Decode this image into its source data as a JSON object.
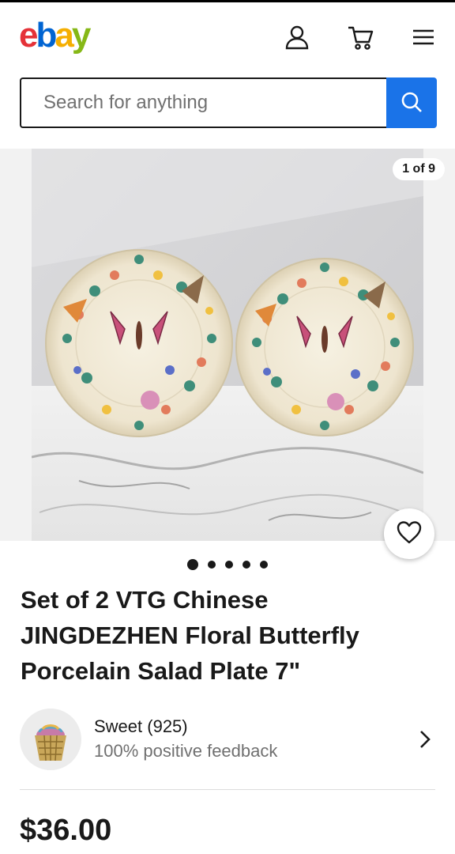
{
  "header": {
    "logo_letters": [
      {
        "ch": "e",
        "color": "#e53238"
      },
      {
        "ch": "b",
        "color": "#0064d2"
      },
      {
        "ch": "a",
        "color": "#f5af02"
      },
      {
        "ch": "y",
        "color": "#86b817"
      }
    ],
    "icons": [
      "user-icon",
      "cart-icon",
      "menu-icon"
    ]
  },
  "search": {
    "placeholder": "Search for anything",
    "button_icon": "search-icon",
    "button_color": "#1a73e8"
  },
  "gallery": {
    "counter": "1 of 9",
    "current_index": 1,
    "total": 9,
    "dots_visible": 5
  },
  "listing": {
    "title": "Set of 2 VTG Chinese JINGDEZHEN Floral Butterfly Porcelain Salad Plate 7\"",
    "price": "$36.00"
  },
  "seller": {
    "name": "Sweet (925)",
    "feedback": "100% positive feedback"
  }
}
